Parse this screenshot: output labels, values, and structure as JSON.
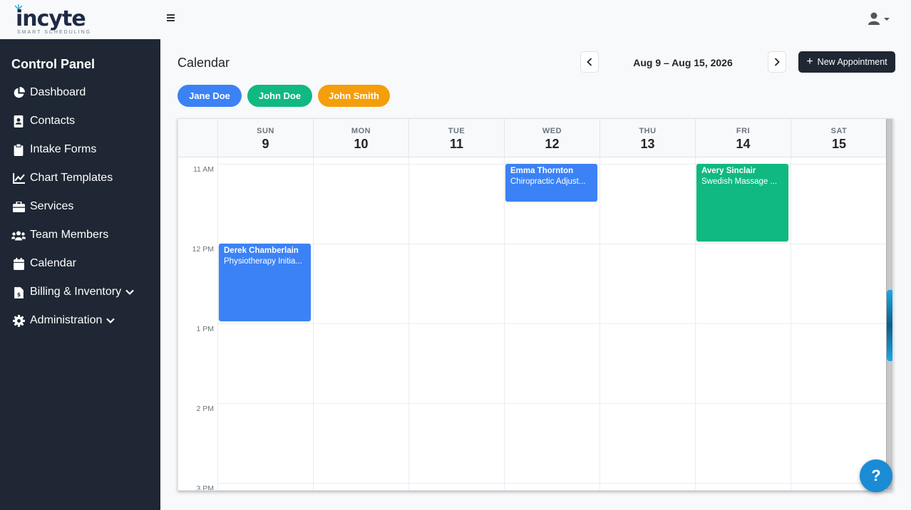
{
  "brand": {
    "name": "incyte",
    "tagline": "SMART SCHEDULING",
    "color": "#1e2b48"
  },
  "sidebar": {
    "title": "Control Panel",
    "items": [
      {
        "label": "Dashboard",
        "icon": "chart-pie-icon"
      },
      {
        "label": "Contacts",
        "icon": "address-book-icon"
      },
      {
        "label": "Intake Forms",
        "icon": "clipboard-icon"
      },
      {
        "label": "Chart Templates",
        "icon": "line-chart-icon"
      },
      {
        "label": "Services",
        "icon": "briefcase-icon"
      },
      {
        "label": "Team Members",
        "icon": "users-icon"
      },
      {
        "label": "Calendar",
        "icon": "calendar-icon"
      },
      {
        "label": "Billing & Inventory",
        "icon": "invoice-icon",
        "expandable": true
      },
      {
        "label": "Administration",
        "icon": "gear-icon",
        "expandable": true
      }
    ]
  },
  "main": {
    "title": "Calendar",
    "date_range": "Aug 9 – Aug 15, 2026",
    "new_button": "New Appointment"
  },
  "staff": [
    {
      "name": "Jane Doe",
      "color": "#3b82f6"
    },
    {
      "name": "John Doe",
      "color": "#10b981"
    },
    {
      "name": "John Smith",
      "color": "#f59e0b"
    }
  ],
  "calendar": {
    "days": [
      {
        "name": "SUN",
        "date": "9"
      },
      {
        "name": "MON",
        "date": "10"
      },
      {
        "name": "TUE",
        "date": "11"
      },
      {
        "name": "WED",
        "date": "12"
      },
      {
        "name": "THU",
        "date": "13"
      },
      {
        "name": "FRI",
        "date": "14"
      },
      {
        "name": "SAT",
        "date": "15"
      }
    ],
    "time_labels": [
      "11 AM",
      "12 PM",
      "1 PM",
      "2 PM",
      "3 PM"
    ],
    "events": [
      {
        "title": "Emma Thornton",
        "service": "Chiropractic Adjust...",
        "day": 3,
        "start": 11.0,
        "end": 11.5,
        "color": "#3b82f6"
      },
      {
        "title": "Avery Sinclair",
        "service": "Swedish Massage ...",
        "day": 5,
        "start": 11.0,
        "end": 12.0,
        "color": "#10b981"
      },
      {
        "title": "Derek Chamberlain",
        "service": "Physiotherapy Initia...",
        "day": 0,
        "start": 12.0,
        "end": 13.0,
        "color": "#3b82f6"
      }
    ]
  },
  "help": {
    "label": "?"
  }
}
